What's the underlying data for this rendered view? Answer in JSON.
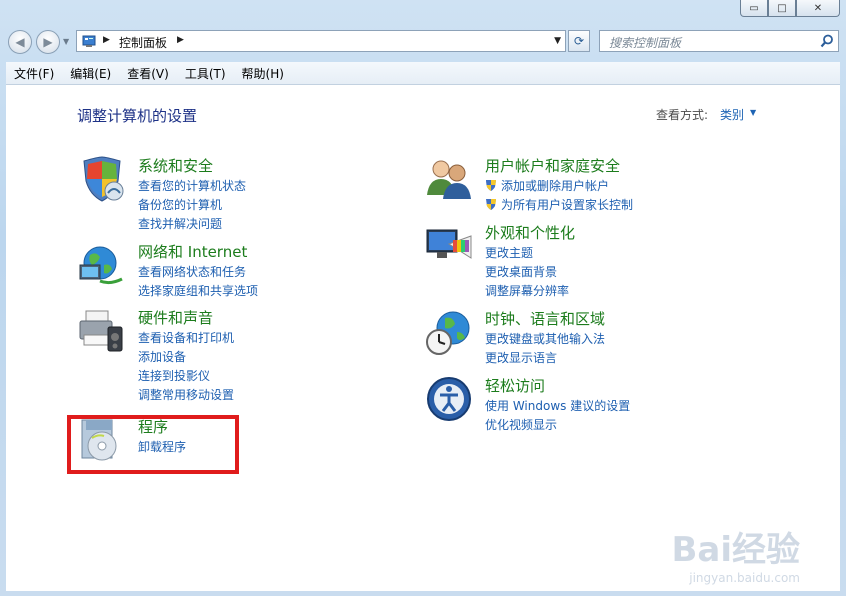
{
  "window": {
    "min_symbol": "▭",
    "max_symbol": "□",
    "close_symbol": "✕"
  },
  "nav": {
    "back_icon": "back-arrow-icon",
    "forward_icon": "forward-arrow-icon"
  },
  "address": {
    "crumb": "控制面板"
  },
  "search": {
    "placeholder": "搜索控制面板"
  },
  "menu": [
    "文件(F)",
    "编辑(E)",
    "查看(V)",
    "工具(T)",
    "帮助(H)"
  ],
  "main": {
    "title": "调整计算机的设置",
    "view_by_label": "查看方式:",
    "view_by_value": "类别"
  },
  "categories": {
    "security": {
      "title": "系统和安全",
      "links": [
        "查看您的计算机状态",
        "备份您的计算机",
        "查找并解决问题"
      ]
    },
    "network": {
      "title": "网络和 Internet",
      "links": [
        "查看网络状态和任务",
        "选择家庭组和共享选项"
      ]
    },
    "hardware": {
      "title": "硬件和声音",
      "links": [
        "查看设备和打印机",
        "添加设备",
        "连接到投影仪",
        "调整常用移动设置"
      ]
    },
    "programs": {
      "title": "程序",
      "links": [
        "卸载程序"
      ]
    },
    "users": {
      "title": "用户帐户和家庭安全",
      "links": [
        "添加或删除用户帐户",
        "为所有用户设置家长控制"
      ]
    },
    "appearance": {
      "title": "外观和个性化",
      "links": [
        "更改主题",
        "更改桌面背景",
        "调整屏幕分辨率"
      ]
    },
    "clock": {
      "title": "时钟、语言和区域",
      "links": [
        "更改键盘或其他输入法",
        "更改显示语言"
      ]
    },
    "ease": {
      "title": "轻松访问",
      "links": [
        "使用 Windows 建议的设置",
        "优化视频显示"
      ]
    }
  },
  "watermark": {
    "brand": "Bai经验",
    "url": "jingyan.baidu.com"
  },
  "colors": {
    "category_title": "#1c7c1c",
    "link": "#1e5fb0",
    "page_title": "#1e3287",
    "highlight": "#e01c1c"
  }
}
